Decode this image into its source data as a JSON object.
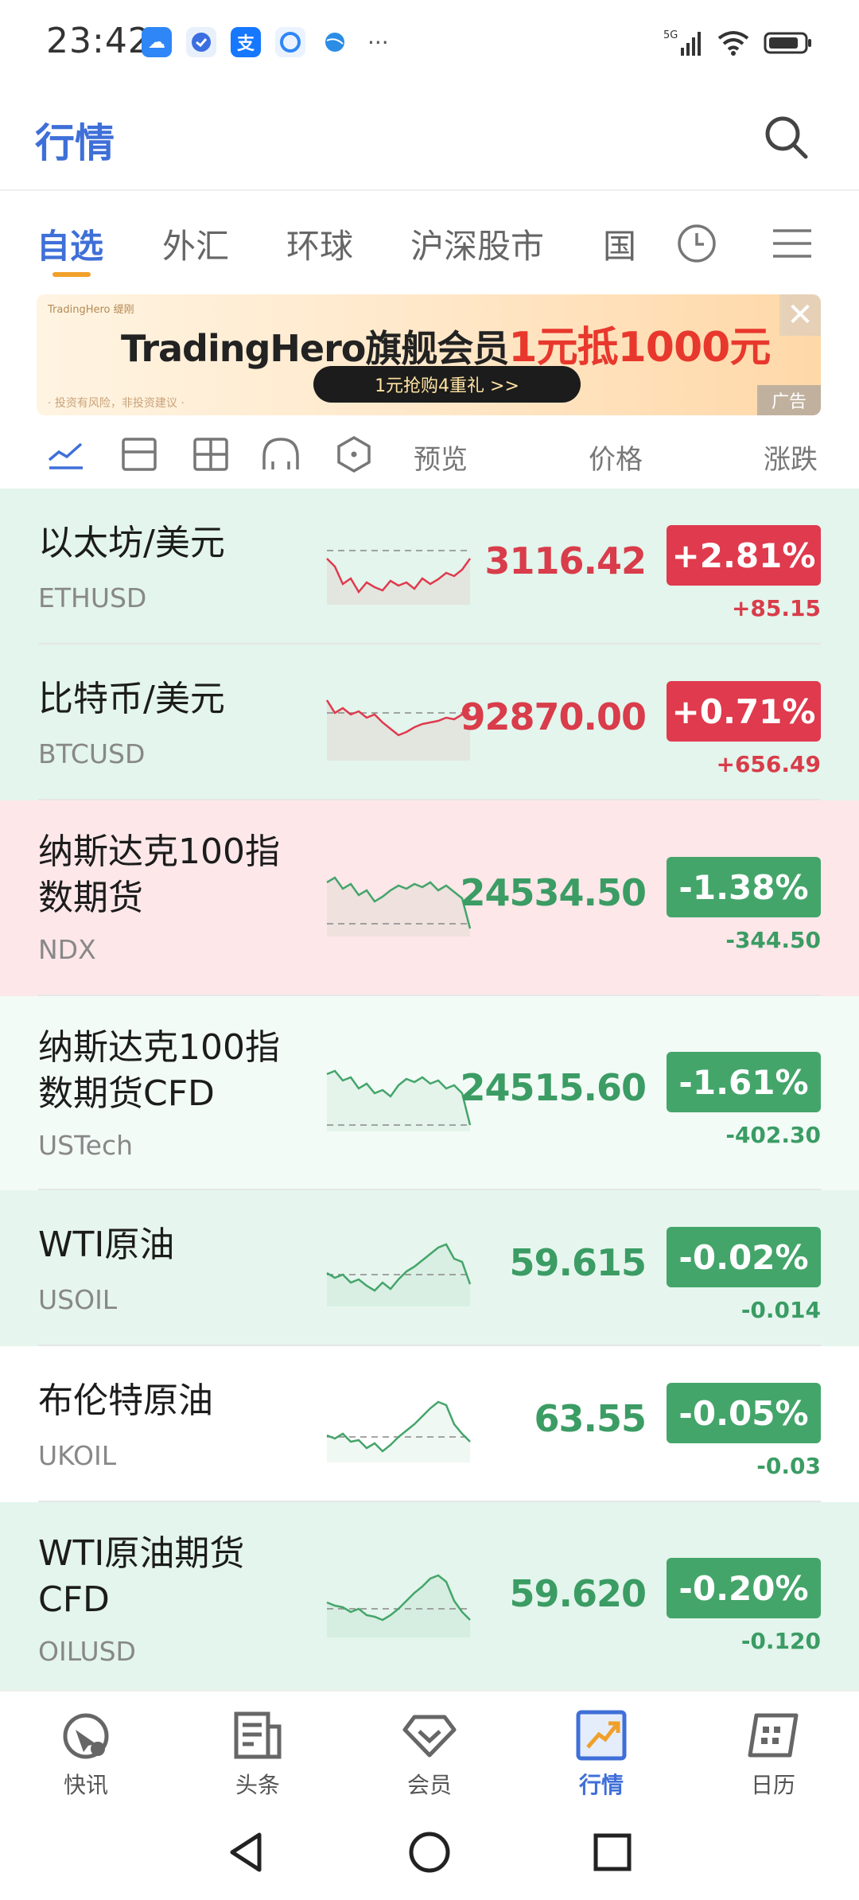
{
  "status_bar": {
    "time": "23:42",
    "more": "···",
    "network": "5G"
  },
  "header": {
    "title": "行情"
  },
  "tabs": [
    {
      "label": "自选",
      "active": true
    },
    {
      "label": "外汇",
      "active": false
    },
    {
      "label": "环球",
      "active": false
    },
    {
      "label": "沪深股市",
      "active": false
    },
    {
      "label": "国",
      "active": false
    }
  ],
  "banner": {
    "small_text": "TradingHero 缇刚",
    "main_text": "TradingHero旗舰会员",
    "highlight": "1元抵1000元",
    "button": "1元抢购4重礼 >>",
    "disclaimer": "· 投资有风险，非投资建议 ·",
    "ad_label": "广告",
    "close": "✕"
  },
  "columns": {
    "preview": "预览",
    "price": "价格",
    "change": "涨跌"
  },
  "quotes": [
    {
      "name": "以太坊/美元",
      "code": "ETHUSD",
      "price": "3116.42",
      "pct": "+2.81%",
      "change": "+85.15",
      "dir": "up",
      "bg": "#e3f5ec",
      "spark": [
        30,
        40,
        62,
        55,
        72,
        60,
        66,
        70,
        58,
        64,
        60,
        68,
        55,
        62,
        56,
        48,
        52,
        44,
        30
      ],
      "base": 20
    },
    {
      "name": "比特币/美元",
      "code": "BTCUSD",
      "price": "92870.00",
      "pct": "+0.71%",
      "change": "+656.49",
      "dir": "up",
      "bg": "#e3f5ec",
      "spark": [
        12,
        28,
        22,
        30,
        26,
        34,
        30,
        40,
        48,
        56,
        52,
        46,
        42,
        40,
        38,
        34,
        36,
        30,
        24
      ],
      "base": 28
    },
    {
      "name": "纳斯达克100指数期货",
      "code": "NDX",
      "price": "24534.50",
      "pct": "-1.38%",
      "change": "-344.50",
      "dir": "down",
      "bg": "#fde7e9",
      "spark": [
        20,
        14,
        28,
        22,
        36,
        30,
        44,
        38,
        30,
        24,
        28,
        22,
        26,
        20,
        30,
        24,
        32,
        40,
        78
      ],
      "base": 72
    },
    {
      "name": "纳斯达克100指数期货CFD",
      "code": "USTech",
      "price": "24515.60",
      "pct": "-1.61%",
      "change": "-402.30",
      "dir": "down",
      "bg": "#f3fbf7",
      "spark": [
        16,
        12,
        24,
        20,
        34,
        28,
        40,
        36,
        44,
        30,
        22,
        26,
        20,
        28,
        24,
        34,
        30,
        40,
        80
      ],
      "base": 80
    },
    {
      "name": "WTI原油",
      "code": "USOIL",
      "price": "59.615",
      "pct": "-0.02%",
      "change": "-0.014",
      "dir": "down",
      "bg": "#e6f6ee",
      "spark": [
        46,
        52,
        48,
        58,
        54,
        62,
        68,
        58,
        66,
        54,
        44,
        38,
        30,
        22,
        14,
        10,
        28,
        32,
        60
      ],
      "base": 48
    },
    {
      "name": "布伦特原油",
      "code": "UKOIL",
      "price": "63.55",
      "pct": "-0.05%",
      "change": "-0.03",
      "dir": "down",
      "bg": "#ffffff",
      "spark": [
        54,
        58,
        52,
        62,
        60,
        70,
        64,
        74,
        66,
        56,
        48,
        40,
        30,
        20,
        12,
        16,
        40,
        52,
        62
      ],
      "base": 56
    },
    {
      "name": "WTI原油期货CFD",
      "code": "OILUSD",
      "price": "59.620",
      "pct": "-0.20%",
      "change": "-0.120",
      "dir": "down",
      "bg": "#e3f5ec",
      "spark": [
        44,
        48,
        50,
        56,
        52,
        60,
        62,
        66,
        60,
        52,
        42,
        32,
        24,
        14,
        10,
        18,
        42,
        56,
        66
      ],
      "base": 52
    }
  ],
  "bottom_nav": [
    {
      "label": "快讯",
      "icon": "flash-news-icon",
      "active": false
    },
    {
      "label": "头条",
      "icon": "headlines-icon",
      "active": false
    },
    {
      "label": "会员",
      "icon": "membership-icon",
      "active": false
    },
    {
      "label": "行情",
      "icon": "market-icon",
      "active": true
    },
    {
      "label": "日历",
      "icon": "calendar-icon",
      "active": false
    }
  ],
  "colors": {
    "accent": "#3f6fd8",
    "tab_underline": "#f0a02a",
    "up": "#df3a4d",
    "down": "#44a56a"
  }
}
